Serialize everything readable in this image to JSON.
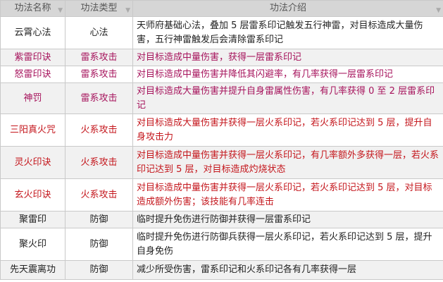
{
  "colors": {
    "thunder": "#a6135c",
    "fire": "#c4161c",
    "neutral": "#222222",
    "header_bg": "#d6d6d6"
  },
  "header": {
    "col_name": "功法名称",
    "col_type": "功法类型",
    "col_desc": "功法介绍"
  },
  "rows": [
    {
      "name": "云霄心法",
      "type": "心法",
      "desc": "天师府基础心法，叠加 5 层雷系印记触发五行神雷，对目标造成大量伤害，五行神雷触发后会清除雷系印记",
      "color": "neutral"
    },
    {
      "name": "紫雷印诀",
      "type": "雷系攻击",
      "desc": "对目标造成中量伤害，获得一层雷系印记",
      "color": "thunder"
    },
    {
      "name": "怒雷印诀",
      "type": "雷系攻击",
      "desc": "对目标造成中量伤害并降低其闪避率，有几率获得一层雷系印记",
      "color": "thunder"
    },
    {
      "name": "神罚",
      "type": "雷系攻击",
      "desc": "对目标造成大量伤害并提升自身雷属性伤害，有几率获得 0 至 2 层雷系印记",
      "color": "thunder"
    },
    {
      "name": "三阳真火咒",
      "type": "火系攻击",
      "desc": "对目标造成大量伤害并获得一层火系印记，若火系印记达到 5 层，提升自身攻击力",
      "color": "fire"
    },
    {
      "name": "灵火印诀",
      "type": "火系攻击",
      "desc": "对目标造成中量伤害并获得一层火系印记，有几率额外多获得一层，若火系印记达到 5 层，对目标造成灼烧状态",
      "color": "fire"
    },
    {
      "name": "玄火印诀",
      "type": "火系攻击",
      "desc": "对目标造成中量伤害并获得一层火系印记，若火系印记达到 5 层，对目标造成额外伤害；该技能有几率连击",
      "color": "fire"
    },
    {
      "name": "聚雷印",
      "type": "防御",
      "desc": "临时提升免伤进行防御并获得一层雷系印记",
      "color": "neutral"
    },
    {
      "name": "聚火印",
      "type": "防御",
      "desc": "临时提升免伤进行防御兵获得一层火系印记，若火系印记达到 5 层，提升自身免伤",
      "color": "neutral"
    },
    {
      "name": "先天震离功",
      "type": "防御",
      "desc": "减少所受伤害，雷系印记和火系印记各有几率获得一层",
      "color": "neutral"
    }
  ]
}
